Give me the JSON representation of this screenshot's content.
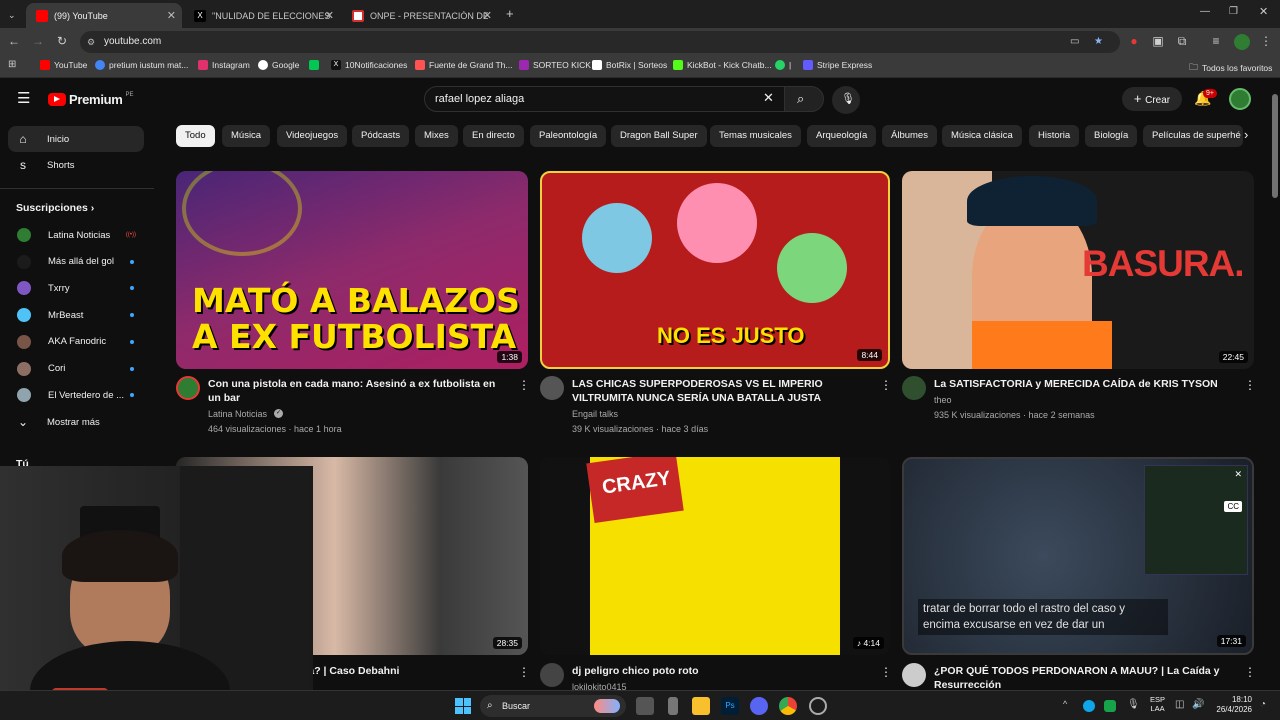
{
  "tabs": [
    {
      "title": "(99) YouTube",
      "favicon_color": "#ff0000"
    },
    {
      "title": "\"NULIDAD DE ELECCIONES YA\"",
      "favicon_color": "#000000"
    },
    {
      "title": "ONPE - PRESENTACIÓN DE RES",
      "favicon_color": "#d32f2f"
    }
  ],
  "new_tab": "+",
  "address": "youtube.com",
  "bookmarks": [
    {
      "label": "YouTube",
      "color": "#ff0000"
    },
    {
      "label": "pretium iustum mat...",
      "color": "#4285f4"
    },
    {
      "label": "Instagram",
      "color": "#e1306c"
    },
    {
      "label": "Google",
      "color": "#34a853"
    },
    {
      "label": "",
      "color": "#00c853"
    },
    {
      "label": "10Notificaciones",
      "color": "#111111"
    },
    {
      "label": "Fuente de Grand Th...",
      "color": "#ff5252"
    },
    {
      "label": "SORTEO KICK",
      "color": "#9c27b0"
    },
    {
      "label": "BotRix | Sorteos",
      "color": "#ffffff"
    },
    {
      "label": "KickBot - Kick Chatb...",
      "color": "#53fc18"
    },
    {
      "label": "|",
      "color": "#25d366"
    },
    {
      "label": "Stripe Express",
      "color": "#635bff"
    }
  ],
  "all_bookmarks": "Todos los favoritos",
  "masthead": {
    "logo": "Premium",
    "region": "PE",
    "search_query": "rafael lopez aliaga",
    "create_label": "Crear",
    "notif_badge": "9+"
  },
  "chips": [
    "Todo",
    "Música",
    "Videojuegos",
    "Pódcasts",
    "Mixes",
    "En directo",
    "Paleontología",
    "Dragon Ball Super",
    "Temas musicales",
    "Arqueología",
    "Álbumes",
    "Música clásica",
    "Historia",
    "Biología",
    "Películas de superhé"
  ],
  "sidebar": {
    "items": [
      {
        "label": "Inicio",
        "icon": "home-icon"
      },
      {
        "label": "Shorts",
        "icon": "shorts-icon"
      }
    ],
    "subs_title": "Suscripciones",
    "subs": [
      {
        "label": "Latina Noticias",
        "color": "#2e7d32",
        "live": true
      },
      {
        "label": "Más allá del gol",
        "color": "#1b1b1b",
        "live": false
      },
      {
        "label": "Txrry",
        "color": "#7e57c2",
        "live": false
      },
      {
        "label": "MrBeast",
        "color": "#4fc3f7",
        "live": false
      },
      {
        "label": "AKA Fanodric",
        "color": "#795548",
        "live": false
      },
      {
        "label": "Cori",
        "color": "#8d6e63",
        "live": false
      },
      {
        "label": "El Vertedero de ...",
        "color": "#90a4ae",
        "live": false
      }
    ],
    "show_more": "Mostrar más",
    "you": "Tú"
  },
  "videos": [
    {
      "title": "Con una pistola en cada mano: Asesinó a ex futbolista en un bar",
      "channel": "Latina Noticias",
      "meta": "464 visualizaciones · hace 1 hora",
      "duration": "1:38",
      "thumb_text": "MATÓ A BALAZOS A EX FUTBOLISTA",
      "thumb_color": "#8e2a6b",
      "avatar_color": "#2e7d32"
    },
    {
      "title": "LAS CHICAS SUPERPODEROSAS VS EL IMPERIO VILTRUMITA NUNCA SERÍA UNA BATALLA JUSTA",
      "channel": "Engail talks",
      "meta": "39 K visualizaciones · hace 3 días",
      "duration": "8:44",
      "thumb_text": "NO ES JUSTO",
      "thumb_color": "#b71c1c",
      "avatar_color": "#555555"
    },
    {
      "title": "La SATISFACTORIA y MERECIDA CAÍDA de KRIS TYSON",
      "channel": "theo",
      "meta": "935 K visualizaciones · hace 2 semanas",
      "duration": "22:45",
      "thumb_text": "BASURA.",
      "thumb_color": "#1a1a1a",
      "avatar_color": "#2f4f2f"
    },
    {
      "title": "¿Qué se Sabe de Ella? | Caso Debahni",
      "channel": "",
      "meta": "",
      "duration": "28:35",
      "thumb_text": "",
      "thumb_color": "#3a3a3a",
      "avatar_color": "#444444"
    },
    {
      "title": "dj peligro chico poto roto",
      "channel": "lokilokito0415",
      "meta": "",
      "duration": "4:14",
      "thumb_text": "CRAZY",
      "thumb_color": "#f5e000",
      "avatar_color": "#444444"
    },
    {
      "title": "¿POR QUÉ TODOS PERDONARON A MAUU? | La Caída y Resurrección",
      "channel": "",
      "meta": "",
      "duration": "17:31",
      "thumb_text": "tratar de borrar todo el rastro del caso y encima excusarse en vez de dar un",
      "thumb_color": "#2b3340",
      "avatar_color": "#cccccc"
    }
  ],
  "taskbar": {
    "search": "Buscar",
    "lang": "ESP",
    "lang2": "LAA",
    "time": "18:10",
    "date": "26/4/2026"
  }
}
